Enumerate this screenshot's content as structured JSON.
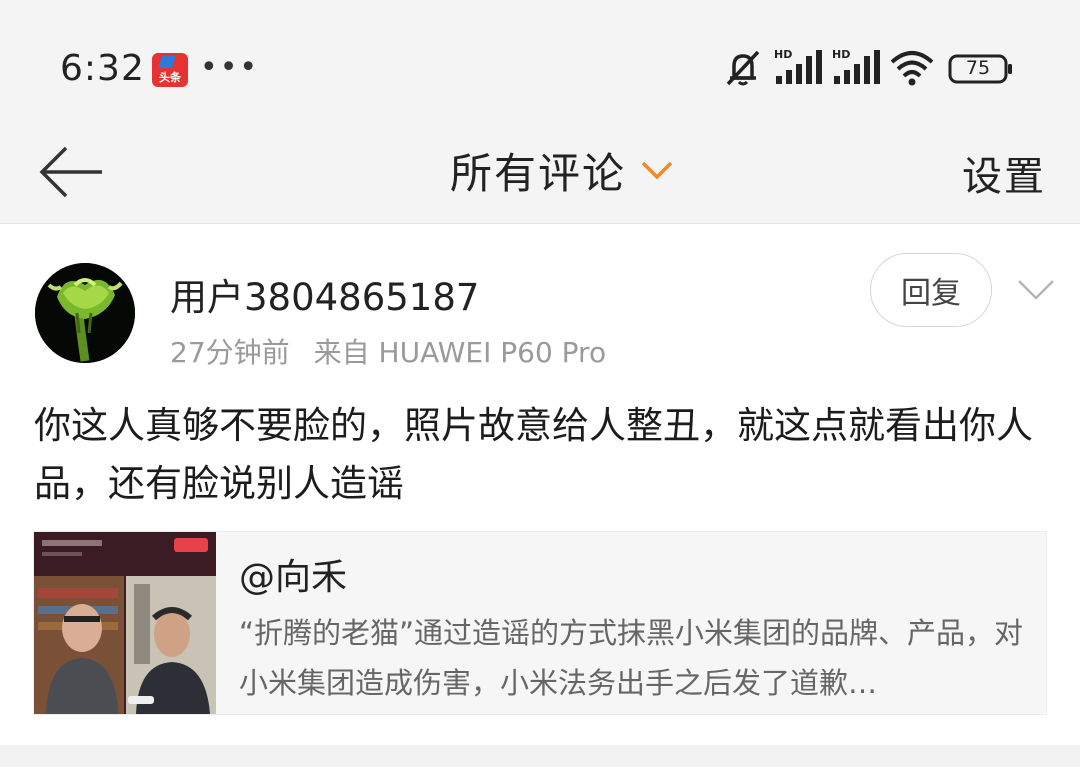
{
  "status_bar": {
    "time": "6:32",
    "app_badge_text": "头条",
    "more": "•••",
    "battery": "75",
    "signal_1_label": "HD",
    "signal_2_label": "HD"
  },
  "header": {
    "title": "所有评论",
    "settings_label": "设置"
  },
  "comment": {
    "username": "用户3804865187",
    "time_ago": "27分钟前",
    "source": "来自 HUAWEI P60 Pro",
    "reply_label": "回复",
    "text": "你这人真够不要脸的，照片故意给人整丑，就这点就看出你人品，还有脸说别人造谣"
  },
  "linked_post": {
    "author": "@向禾",
    "excerpt": "“折腾的老猫”通过造谣的方式抹黑小米集团的品牌、产品，对小米集团造成伤害，小米法务出手之后发了道歉…"
  },
  "colors": {
    "accent": "#f08a24",
    "background": "#f4f4f4",
    "text": "#222222",
    "meta": "#9a9a9a"
  },
  "icons": {
    "back": "back-arrow-icon",
    "dropdown": "chevron-down-icon",
    "expand": "chevron-down-icon",
    "mute": "bell-muted-icon",
    "signal": "signal-icon",
    "wifi": "wifi-icon",
    "battery": "battery-icon"
  }
}
